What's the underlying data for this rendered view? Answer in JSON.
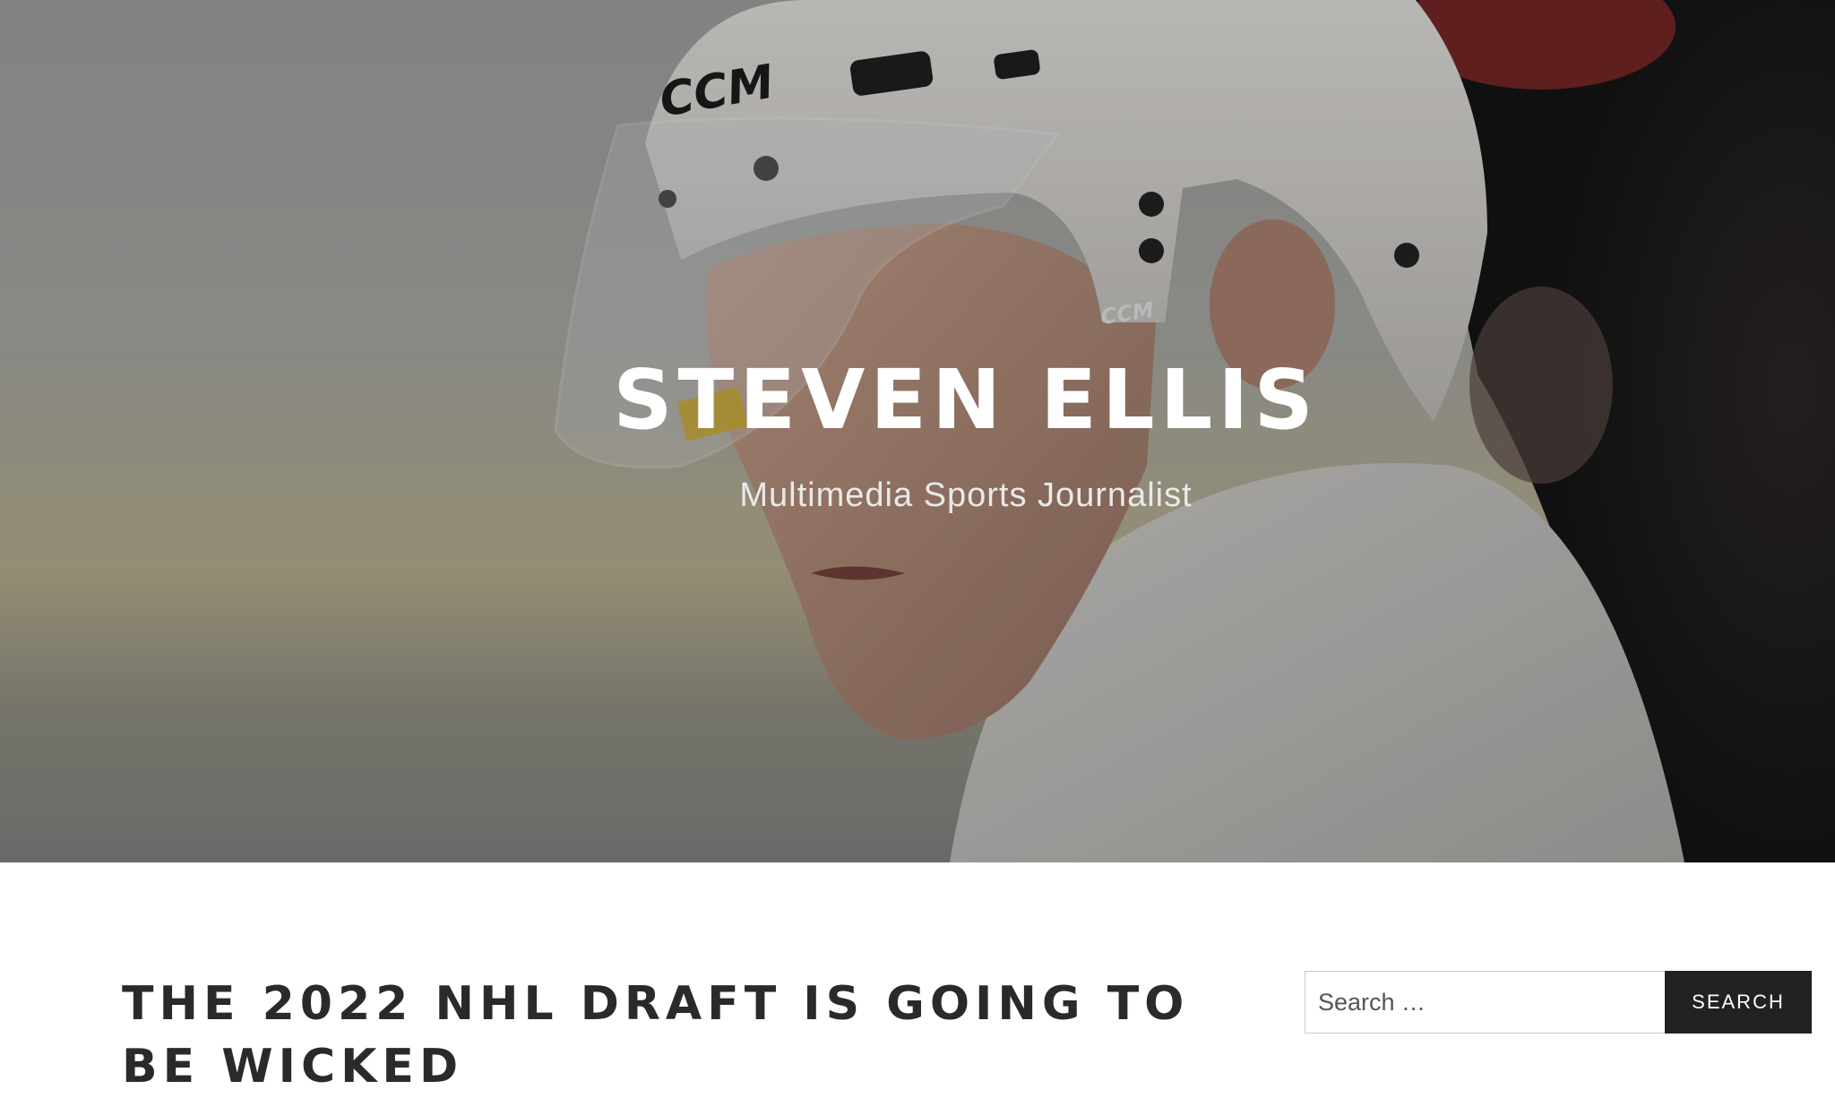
{
  "site": {
    "title": "STEVEN ELLIS",
    "tagline": "Multimedia Sports Journalist"
  },
  "hero": {
    "helmet_brand": "CCM"
  },
  "post": {
    "title": "THE 2022 NHL DRAFT IS GOING TO BE WICKED"
  },
  "search": {
    "placeholder": "Search …",
    "button_label": "SEARCH"
  },
  "colors": {
    "text_dark": "#2a2a2a",
    "button_bg": "#222222",
    "white": "#ffffff"
  }
}
